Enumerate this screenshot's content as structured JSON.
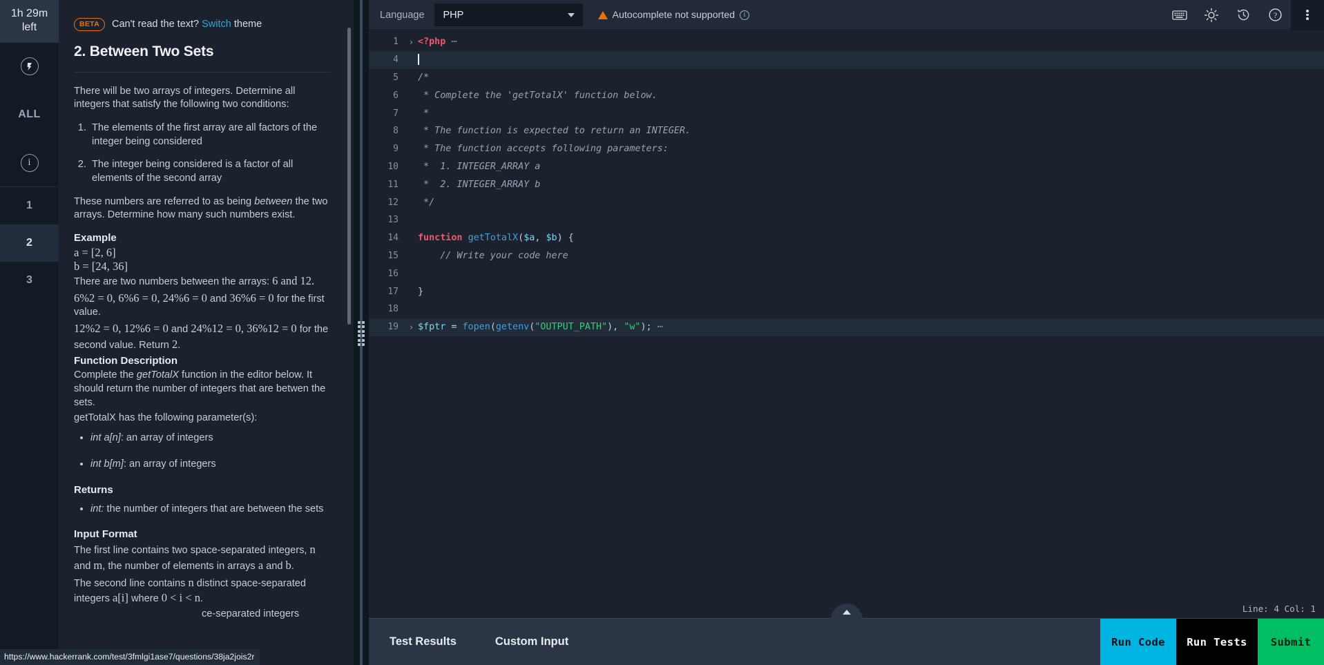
{
  "rail": {
    "timer": "1h 29m left",
    "logo_icon": "hackerrank-logo-icon",
    "all_label": "ALL",
    "info_icon": "info-icon",
    "questions": [
      "1",
      "2",
      "3"
    ],
    "active_question": "2"
  },
  "problem": {
    "beta_badge": "BETA",
    "beta_prefix": "Can't read the text? ",
    "beta_link": "Switch",
    "beta_suffix": " theme",
    "title": "2. Between Two Sets",
    "intro": "There will be two arrays of integers. Determine all integers that satisfy the following two conditions:",
    "conditions": [
      "The elements of the first array are all factors of the integer being considered",
      "The integer being considered is a factor of all elements of the second array"
    ],
    "between_line_1": "These numbers are referred to as being ",
    "between_em": "between",
    "between_line_2": " the two arrays. Determine how many such numbers exist.",
    "example_heading": "Example",
    "math_a": "a = [2, 6]",
    "math_b": "b = [24, 36]",
    "two_numbers_pre": "There are two numbers between the arrays: ",
    "two_numbers_vals": "6 and 12.",
    "first_math": "6%2 = 0, 6%6 = 0, 24%6 = 0",
    "first_mid": " and ",
    "first_math2": "36%6 = 0",
    "first_tail": " for the first value.",
    "second_math": "12%2 = 0, 12%6 = 0",
    "second_mid": " and ",
    "second_math2": "24%12 = 0, 36%12 = 0",
    "second_tail": " for the second value. Return ",
    "second_return": "2",
    "second_dot": ".",
    "func_desc_heading": "Function Description",
    "func_desc_pre": "Complete the ",
    "func_desc_em": "getTotalX",
    "func_desc_post": " function in the editor below. It should return the number of integers that are betwen the sets.",
    "func_params_line": "getTotalX has the following parameter(s):",
    "params": [
      {
        "em": "int a[n]",
        "rest": ": an array of integers"
      },
      {
        "em": "int b[m]",
        "rest": ": an array of integers"
      }
    ],
    "returns_heading": "Returns",
    "returns": [
      {
        "em": "int:",
        "rest": " the number of integers that are between the sets"
      }
    ],
    "input_format_heading": "Input Format",
    "input_line_1a": "The first line contains two space-separated integers, ",
    "input_line_1b": "n",
    "input_line_1c": " and ",
    "input_line_1d": "m",
    "input_line_1e": ", the number of elements in arrays ",
    "input_line_1f": "a",
    "input_line_1g": " and ",
    "input_line_1h": "b",
    "input_line_1i": ".",
    "input_line_2a": "The second line contains ",
    "input_line_2b": "n",
    "input_line_2c": " distinct space-separated integers ",
    "input_line_2d": "a[i]",
    "input_line_2e": " where ",
    "input_line_2f": "0 < i < n",
    "input_line_2g": ".",
    "input_line_3": "ce-separated integers"
  },
  "editor": {
    "language_label": "Language",
    "language_value": "PHP",
    "autocomplete_warning": "Autocomplete not supported",
    "warning_icon": "warning-triangle-icon",
    "info_icon": "info-circle-icon",
    "chevron_icon": "chevron-down-icon",
    "toolbar_icons": [
      "keyboard-icon",
      "brightness-icon",
      "history-icon",
      "help-icon",
      "kebab-menu-icon"
    ],
    "status": "Line: 4 Col: 1",
    "lines": [
      {
        "n": "1",
        "fold": "›",
        "active": false,
        "tokens": [
          {
            "t": "kw",
            "v": "<?php"
          },
          {
            "t": "el",
            "v": " ⋯"
          }
        ]
      },
      {
        "n": "4",
        "fold": "",
        "active": true,
        "tokens": [
          {
            "t": "cursor",
            "v": ""
          }
        ]
      },
      {
        "n": "5",
        "fold": "",
        "active": false,
        "tokens": [
          {
            "t": "cm",
            "v": "/*"
          }
        ]
      },
      {
        "n": "6",
        "fold": "",
        "active": false,
        "tokens": [
          {
            "t": "cm",
            "v": " * Complete the 'getTotalX' function below."
          }
        ]
      },
      {
        "n": "7",
        "fold": "",
        "active": false,
        "tokens": [
          {
            "t": "cm",
            "v": " *"
          }
        ]
      },
      {
        "n": "8",
        "fold": "",
        "active": false,
        "tokens": [
          {
            "t": "cm",
            "v": " * The function is expected to return an INTEGER."
          }
        ]
      },
      {
        "n": "9",
        "fold": "",
        "active": false,
        "tokens": [
          {
            "t": "cm",
            "v": " * The function accepts following parameters:"
          }
        ]
      },
      {
        "n": "10",
        "fold": "",
        "active": false,
        "tokens": [
          {
            "t": "cm",
            "v": " *  1. INTEGER_ARRAY a"
          }
        ]
      },
      {
        "n": "11",
        "fold": "",
        "active": false,
        "tokens": [
          {
            "t": "cm",
            "v": " *  2. INTEGER_ARRAY b"
          }
        ]
      },
      {
        "n": "12",
        "fold": "",
        "active": false,
        "tokens": [
          {
            "t": "cm",
            "v": " */"
          }
        ]
      },
      {
        "n": "13",
        "fold": "",
        "active": false,
        "tokens": []
      },
      {
        "n": "14",
        "fold": "",
        "active": false,
        "tokens": [
          {
            "t": "kw",
            "v": "function"
          },
          {
            "t": "pl",
            "v": " "
          },
          {
            "t": "fn",
            "v": "getTotalX"
          },
          {
            "t": "pl",
            "v": "("
          },
          {
            "t": "var",
            "v": "$a"
          },
          {
            "t": "pl",
            "v": ", "
          },
          {
            "t": "var",
            "v": "$b"
          },
          {
            "t": "pl",
            "v": ") {"
          }
        ]
      },
      {
        "n": "15",
        "fold": "",
        "active": false,
        "tokens": [
          {
            "t": "cm",
            "v": "    // Write your code here"
          }
        ]
      },
      {
        "n": "16",
        "fold": "",
        "active": false,
        "tokens": []
      },
      {
        "n": "17",
        "fold": "",
        "active": false,
        "tokens": [
          {
            "t": "pl",
            "v": "}"
          }
        ]
      },
      {
        "n": "18",
        "fold": "",
        "active": false,
        "tokens": []
      },
      {
        "n": "19",
        "fold": "›",
        "active": true,
        "tokens": [
          {
            "t": "var",
            "v": "$fptr"
          },
          {
            "t": "pl",
            "v": " = "
          },
          {
            "t": "fn",
            "v": "fopen"
          },
          {
            "t": "pl",
            "v": "("
          },
          {
            "t": "fn",
            "v": "getenv"
          },
          {
            "t": "pl",
            "v": "("
          },
          {
            "t": "str",
            "v": "\"OUTPUT_PATH\""
          },
          {
            "t": "pl",
            "v": "), "
          },
          {
            "t": "str",
            "v": "\"w\""
          },
          {
            "t": "pl",
            "v": ");"
          },
          {
            "t": "el",
            "v": " ⋯"
          }
        ]
      }
    ]
  },
  "bottom": {
    "tabs": [
      "Test Results",
      "Custom Input"
    ],
    "collapse_icon": "chevron-up-icon",
    "buttons": [
      {
        "label": "Run Code",
        "cls": "run-code"
      },
      {
        "label": "Run Tests",
        "cls": "run-tests"
      },
      {
        "label": "Submit",
        "cls": "submit"
      }
    ]
  },
  "status_url": "https://www.hackerrank.com/test/3fmlgi1ase7/questions/38ja2jois2r",
  "colors": {
    "accent_cyan": "#00b5e2",
    "accent_green": "#00bf63",
    "beta_orange": "#e8730a",
    "link_blue": "#2ea7e0"
  }
}
